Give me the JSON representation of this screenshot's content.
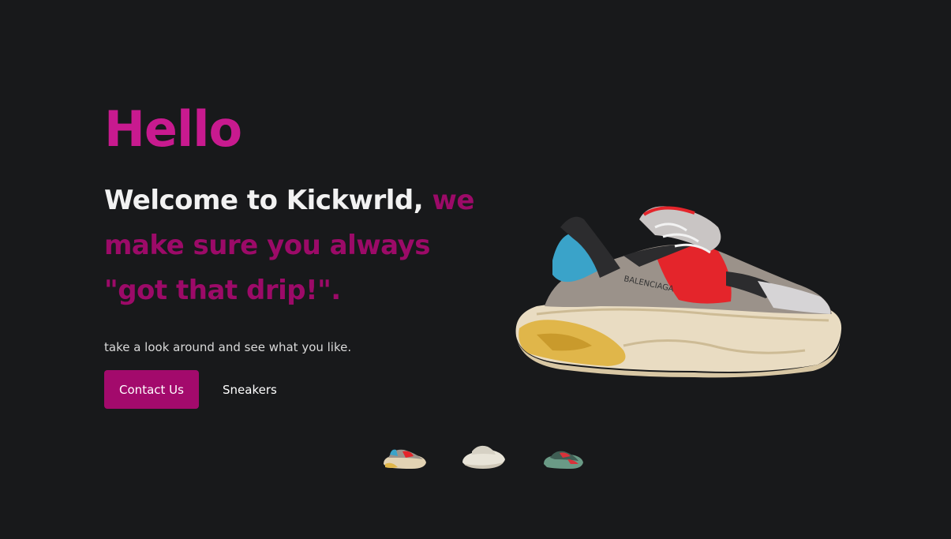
{
  "hero": {
    "hello": "Hello",
    "headline_white": "Welcome to Kickwrld, ",
    "headline_pink": "we make sure you always \"got that drip!\".",
    "tagline": "take a look around and see what you like."
  },
  "buttons": {
    "contact": "Contact Us",
    "sneakers": "Sneakers"
  },
  "main_image": {
    "icon": "balenciaga-triple-s-sneaker",
    "brand_text": "BALENCIAGA"
  },
  "thumbnails": [
    {
      "icon": "sneaker-multicolor-thumbnail"
    },
    {
      "icon": "sneaker-cream-thumbnail"
    },
    {
      "icon": "sneaker-green-red-thumbnail"
    }
  ],
  "colors": {
    "background": "#18191b",
    "accent": "#c81a8f",
    "accent_dark": "#9c0a68",
    "button": "#a30a6c"
  }
}
